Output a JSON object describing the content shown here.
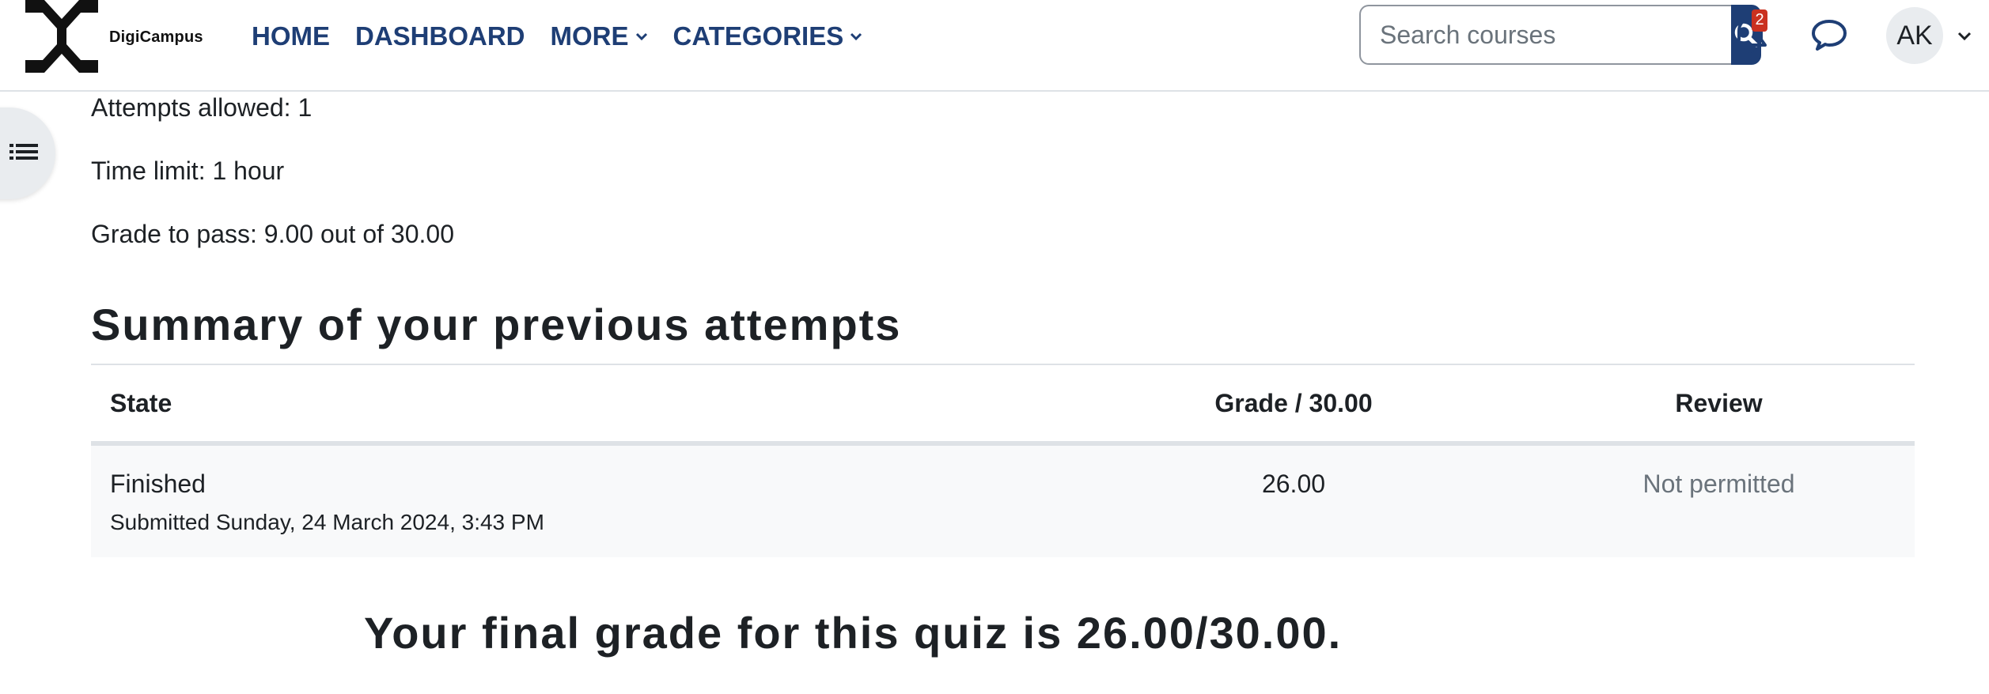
{
  "brand": {
    "name": "DigiCampus"
  },
  "nav": {
    "home": "HOME",
    "dashboard": "DASHBOARD",
    "more": "MORE",
    "categories": "CATEGORIES"
  },
  "search": {
    "placeholder": "Search courses"
  },
  "notifications": {
    "count": "2"
  },
  "user": {
    "initials": "AK"
  },
  "quiz_info": {
    "attempts_allowed": "Attempts allowed: 1",
    "time_limit": "Time limit: 1 hour",
    "grade_to_pass": "Grade to pass: 9.00 out of 30.00"
  },
  "summary": {
    "title": "Summary of your previous attempts",
    "columns": {
      "state": "State",
      "grade": "Grade / 30.00",
      "review": "Review"
    },
    "rows": [
      {
        "state": "Finished",
        "submitted": "Submitted Sunday, 24 March 2024, 3:43 PM",
        "grade": "26.00",
        "review": "Not permitted"
      }
    ]
  },
  "final_grade": "Your final grade for this quiz is 26.00/30.00.",
  "colors": {
    "brand_primary": "#1e3e75",
    "badge": "#ca3120",
    "muted_text": "#6a737b",
    "row_bg": "#f8f9fa"
  },
  "icons": [
    "search-icon",
    "bell-icon",
    "chat-icon",
    "chevron-down-icon",
    "course-index-icon"
  ]
}
